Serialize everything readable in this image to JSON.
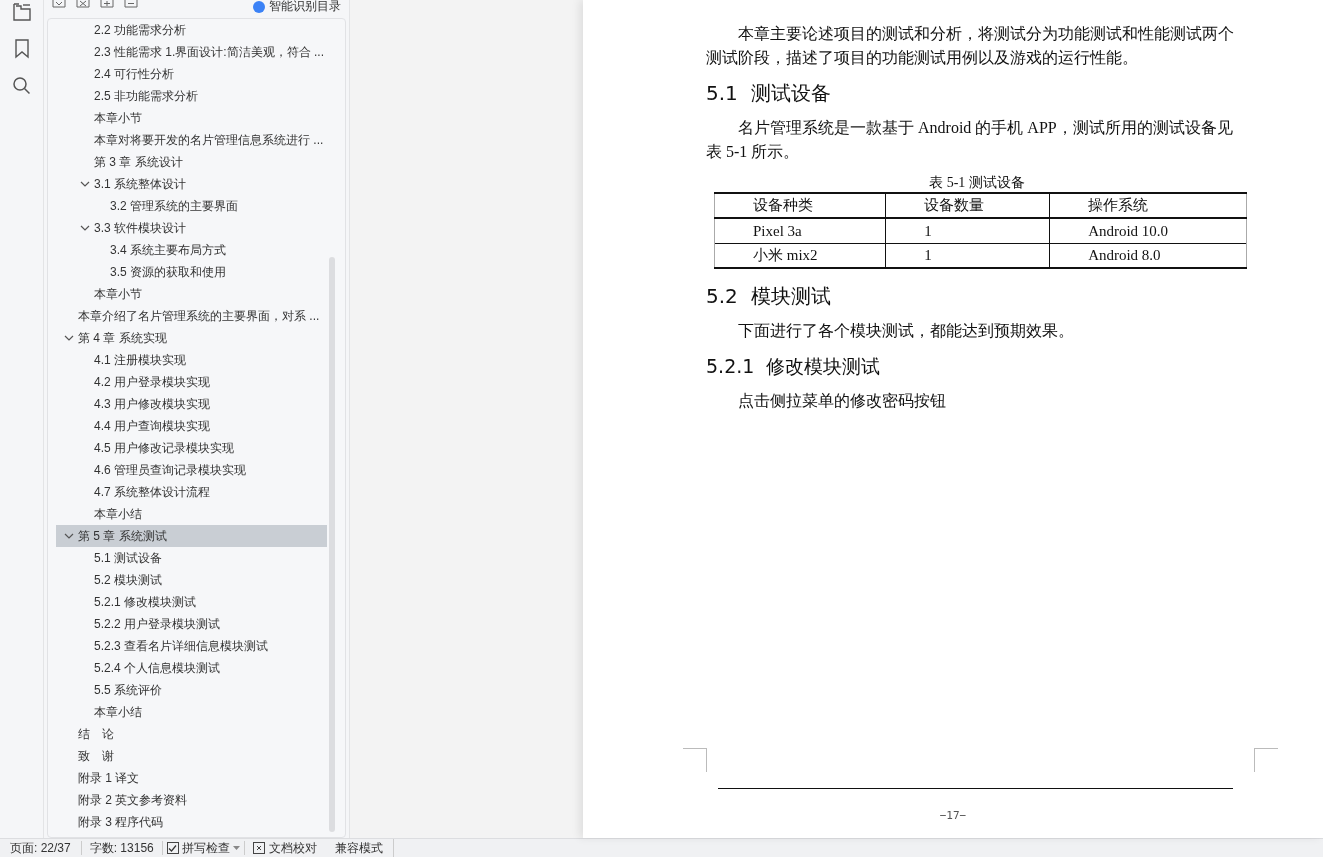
{
  "outline_toolbar": {
    "smart_toc": {
      "label": "智能识别目录",
      "on": true
    }
  },
  "outline": [
    {
      "kind": "continuation",
      "children": [
        {
          "label": "2.2 功能需求分析",
          "selected": false
        },
        {
          "label": "2.3 性能需求 1.界面设计:简洁美观，符合 ...",
          "selected": false
        },
        {
          "label": "2.4 可行性分析",
          "selected": false
        },
        {
          "label": "2.5 非功能需求分析",
          "selected": false
        },
        {
          "label": "本章小节",
          "selected": false
        },
        {
          "label": "本章对将要开发的名片管理信息系统进行 ...",
          "selected": false
        },
        {
          "label": "第 3 章  系统设计",
          "selected": false
        },
        {
          "label": "3.1  系统整体设计",
          "selected": false,
          "expanded": true,
          "children": [
            {
              "label": "3.2 管理系统的主要界面",
              "selected": false
            }
          ]
        },
        {
          "label": "3.3 软件模块设计",
          "selected": false,
          "expanded": true,
          "children": [
            {
              "label": "3.4 系统主要布局方式",
              "selected": false
            },
            {
              "label": "3.5 资源的获取和使用",
              "selected": false
            }
          ]
        },
        {
          "label": "本章小节",
          "selected": false
        }
      ]
    },
    {
      "label": "本章介绍了名片管理系统的主要界面，对系 ...",
      "selected": false
    },
    {
      "label": "第 4 章  系统实现",
      "selected": false,
      "expanded": true,
      "children": [
        {
          "label": "4.1 注册模块实现",
          "selected": false
        },
        {
          "label": "4.2 用户登录模块实现",
          "selected": false
        },
        {
          "label": "4.3 用户修改模块实现",
          "selected": false
        },
        {
          "label": "4.4 用户查询模块实现",
          "selected": false
        },
        {
          "label": "4.5 用户修改记录模块实现",
          "selected": false
        },
        {
          "label": "4.6  管理员查询记录模块实现",
          "selected": false
        },
        {
          "label": "4.7 系统整体设计流程",
          "selected": false
        },
        {
          "label": "本章小结",
          "selected": false
        }
      ]
    },
    {
      "label": "第 5 章  系统测试",
      "selected": true,
      "expanded": true,
      "children": [
        {
          "label": "5.1  测试设备",
          "selected": false
        },
        {
          "label": "5.2  模块测试",
          "selected": false
        },
        {
          "label": "5.2.1  修改模块测试",
          "selected": false
        },
        {
          "label": "5.2.2 用户登录模块测试",
          "selected": false
        },
        {
          "label": "5.2.3 查看名片详细信息模块测试",
          "selected": false
        },
        {
          "label": "5.2.4  个人信息模块测试",
          "selected": false
        },
        {
          "label": "5.5 系统评价",
          "selected": false
        },
        {
          "label": "本章小结",
          "selected": false
        }
      ]
    },
    {
      "label": "结　论",
      "selected": false
    },
    {
      "label": "致　谢",
      "selected": false
    },
    {
      "label": "附录 1  译文",
      "selected": false
    },
    {
      "label": "附录 2  英文参考资料",
      "selected": false
    },
    {
      "label": "附录 3 程序代码",
      "selected": false
    }
  ],
  "document": {
    "blocks": [
      {
        "kind": "paragraph",
        "text": "本章主要论述项目的测试和分析，将测试分为功能测试和性能测试两个测试阶段，描述了项目的功能测试用例以及游戏的运行性能。"
      },
      {
        "kind": "heading",
        "text": "5.1  测试设备"
      },
      {
        "kind": "paragraph",
        "text": "名片管理系统是一款基于 Android 的手机 APP，测试所用的测试设备见表 5-1 所示。"
      },
      {
        "kind": "table",
        "caption": "表 5-1 测试设备",
        "columns": [
          "设备种类",
          "设备数量",
          "操作系统"
        ],
        "rows": [
          [
            "Pixel 3a",
            "1",
            "Android 10.0"
          ],
          [
            "小米 mix2",
            "1",
            "Android 8.0"
          ]
        ]
      },
      {
        "kind": "heading",
        "text": "5.2  模块测试"
      },
      {
        "kind": "paragraph",
        "text": "下面进行了各个模块测试，都能达到预期效果。"
      },
      {
        "kind": "subheading",
        "text": "5.2.1  修改模块测试"
      },
      {
        "kind": "paragraph",
        "text": "点击侧拉菜单的修改密码按钮"
      }
    ],
    "page_number": "−17−"
  },
  "status_bar": {
    "page": "页面: 22/37",
    "words": "字数: 13156",
    "spell_check": {
      "label": "拼写检查",
      "checked": true
    },
    "proofread": {
      "label": "文档校对"
    },
    "compat": "兼容模式"
  }
}
